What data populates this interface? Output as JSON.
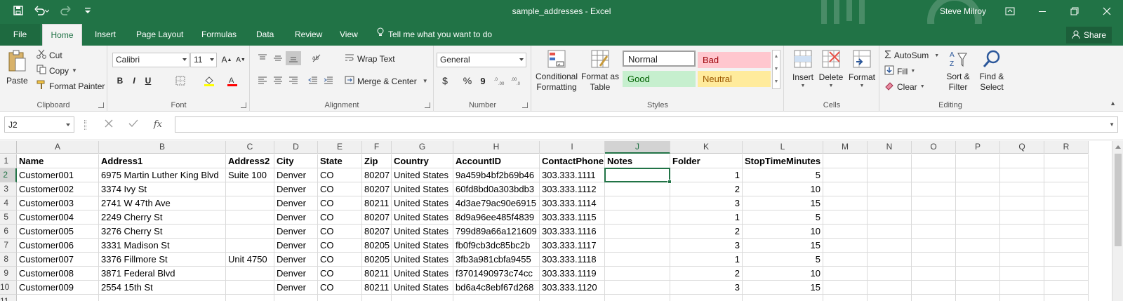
{
  "window": {
    "title": "sample_addresses  -  Excel",
    "user": "Steve Milroy"
  },
  "tabs": [
    "File",
    "Home",
    "Insert",
    "Page Layout",
    "Formulas",
    "Data",
    "Review",
    "View"
  ],
  "tell_me": "Tell me what you want to do",
  "share": "Share",
  "ribbon": {
    "clipboard": {
      "label": "Clipboard",
      "paste": "Paste",
      "cut": "Cut",
      "copy": "Copy",
      "format_painter": "Format Painter"
    },
    "font": {
      "label": "Font",
      "name": "Calibri",
      "size": "11",
      "bold": "B",
      "italic": "I",
      "underline": "U"
    },
    "alignment": {
      "label": "Alignment",
      "wrap_text": "Wrap Text",
      "merge_center": "Merge & Center"
    },
    "number": {
      "label": "Number",
      "format": "General",
      "currency": "$",
      "percent": "%",
      "comma": "9"
    },
    "styles": {
      "label": "Styles",
      "conditional": [
        "Conditional",
        "Formatting"
      ],
      "format_table": [
        "Format as",
        "Table"
      ],
      "normal": "Normal",
      "bad": "Bad",
      "good": "Good",
      "neutral": "Neutral"
    },
    "cells": {
      "label": "Cells",
      "insert": "Insert",
      "delete": "Delete",
      "format": "Format"
    },
    "editing": {
      "label": "Editing",
      "autosum": "AutoSum",
      "fill": "Fill",
      "clear": "Clear",
      "sort_filter": [
        "Sort &",
        "Filter"
      ],
      "find_select": [
        "Find &",
        "Select"
      ]
    }
  },
  "formula_bar": {
    "name_box": "J2",
    "formula": ""
  },
  "columns": [
    "A",
    "B",
    "C",
    "D",
    "E",
    "F",
    "G",
    "H",
    "I",
    "J",
    "K",
    "L",
    "M",
    "N",
    "O",
    "P",
    "Q",
    "R"
  ],
  "rows": [
    [
      "Name",
      "Address1",
      "Address2",
      "City",
      "State",
      "Zip",
      "Country",
      "AccountID",
      "ContactPhone",
      "Notes",
      "Folder",
      "StopTimeMinutes"
    ],
    [
      "Customer001",
      "6975 Martin Luther King Blvd",
      "Suite 100",
      "Denver",
      "CO",
      "80207",
      "United States",
      "9a459b4bf2b69b46",
      "303.333.1111",
      "",
      "1",
      "5"
    ],
    [
      "Customer002",
      "3374 Ivy St",
      "",
      "Denver",
      "CO",
      "80207",
      "United States",
      "60fd8bd0a303bdb3",
      "303.333.1112",
      "",
      "2",
      "10"
    ],
    [
      "Customer003",
      "2741 W 47th Ave",
      "",
      "Denver",
      "CO",
      "80211",
      "United States",
      "4d3ae79ac90e6915",
      "303.333.1114",
      "",
      "3",
      "15"
    ],
    [
      "Customer004",
      "2249 Cherry St",
      "",
      "Denver",
      "CO",
      "80207",
      "United States",
      "8d9a96ee485f4839",
      "303.333.1115",
      "",
      "1",
      "5"
    ],
    [
      "Customer005",
      "3276 Cherry St",
      "",
      "Denver",
      "CO",
      "80207",
      "United States",
      "799d89a66a121609",
      "303.333.1116",
      "",
      "2",
      "10"
    ],
    [
      "Customer006",
      "3331 Madison St",
      "",
      "Denver",
      "CO",
      "80205",
      "United States",
      "fb0f9cb3dc85bc2b",
      "303.333.1117",
      "",
      "3",
      "15"
    ],
    [
      "Customer007",
      "3376 Fillmore St",
      "Unit 4750",
      "Denver",
      "CO",
      "80205",
      "United States",
      "3fb3a981cbfa9455",
      "303.333.1118",
      "",
      "1",
      "5"
    ],
    [
      "Customer008",
      "3871 Federal Blvd",
      "",
      "Denver",
      "CO",
      "80211",
      "United States",
      "f3701490973c74cc",
      "303.333.1119",
      "",
      "2",
      "10"
    ],
    [
      "Customer009",
      "2554 15th St",
      "",
      "Denver",
      "CO",
      "80211",
      "United States",
      "bd6a4c8ebf67d268",
      "303.333.1120",
      "",
      "3",
      "15"
    ]
  ],
  "selected": {
    "col": "J",
    "row": "2"
  },
  "colors": {
    "excel_green": "#217346",
    "bad_fill": "#ffc7ce",
    "good_fill": "#c6efce",
    "neutral_fill": "#ffeb9c"
  }
}
